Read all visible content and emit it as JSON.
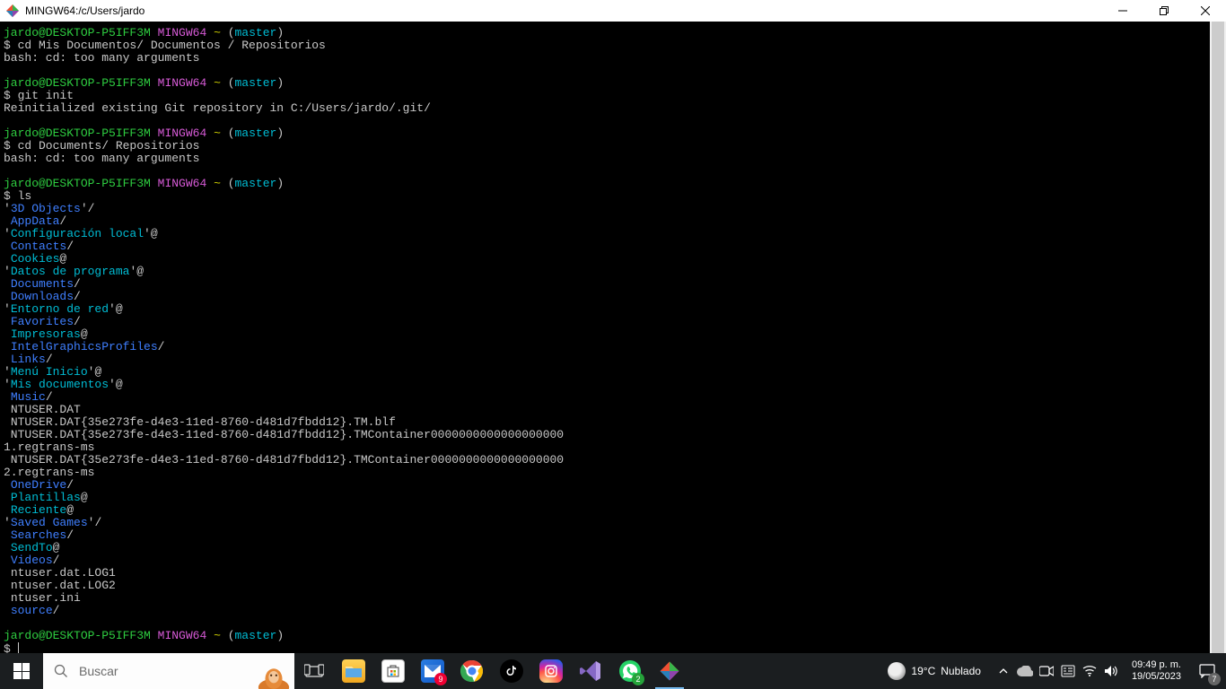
{
  "window": {
    "title": "MINGW64:/c/Users/jardo"
  },
  "prompt": {
    "user_host": "jardo@DESKTOP-P5IFF3M",
    "env": "MINGW64",
    "path": "~",
    "branch_open": "(",
    "branch": "master",
    "branch_close": ")"
  },
  "blocks": [
    {
      "cmd": "$ cd Mis Documentos/ Documentos / Repositorios",
      "out": [
        "bash: cd: too many arguments"
      ]
    },
    {
      "cmd": "$ git init",
      "out": [
        "Reinitialized existing Git repository in C:/Users/jardo/.git/"
      ]
    },
    {
      "cmd": "$ cd Documents/ Repositorios",
      "out": [
        "bash: cd: too many arguments"
      ]
    },
    {
      "cmd": "$ ls",
      "out": []
    }
  ],
  "ls_entries": [
    {
      "pre": "'",
      "name": "3D Objects",
      "suf": "'/",
      "type": "dir"
    },
    {
      "pre": " ",
      "name": "AppData",
      "suf": "/",
      "type": "dir"
    },
    {
      "pre": "'",
      "name": "Configuración local",
      "suf": "'@",
      "type": "link"
    },
    {
      "pre": " ",
      "name": "Contacts",
      "suf": "/",
      "type": "dir"
    },
    {
      "pre": " ",
      "name": "Cookies",
      "suf": "@",
      "type": "link"
    },
    {
      "pre": "'",
      "name": "Datos de programa",
      "suf": "'@",
      "type": "link"
    },
    {
      "pre": " ",
      "name": "Documents",
      "suf": "/",
      "type": "dir"
    },
    {
      "pre": " ",
      "name": "Downloads",
      "suf": "/",
      "type": "dir"
    },
    {
      "pre": "'",
      "name": "Entorno de red",
      "suf": "'@",
      "type": "link"
    },
    {
      "pre": " ",
      "name": "Favorites",
      "suf": "/",
      "type": "dir"
    },
    {
      "pre": " ",
      "name": "Impresoras",
      "suf": "@",
      "type": "link"
    },
    {
      "pre": " ",
      "name": "IntelGraphicsProfiles",
      "suf": "/",
      "type": "dir"
    },
    {
      "pre": " ",
      "name": "Links",
      "suf": "/",
      "type": "dir"
    },
    {
      "pre": "'",
      "name": "Menú Inicio",
      "suf": "'@",
      "type": "link"
    },
    {
      "pre": "'",
      "name": "Mis documentos",
      "suf": "'@",
      "type": "link"
    },
    {
      "pre": " ",
      "name": "Music",
      "suf": "/",
      "type": "dir"
    },
    {
      "pre": " ",
      "name": "NTUSER.DAT",
      "suf": "",
      "type": "file"
    },
    {
      "pre": " ",
      "name": "NTUSER.DAT{35e273fe-d4e3-11ed-8760-d481d7fbdd12}.TM.blf",
      "suf": "",
      "type": "file"
    },
    {
      "pre": " ",
      "name": "NTUSER.DAT{35e273fe-d4e3-11ed-8760-d481d7fbdd12}.TMContainer00000000000000000001.regtrans-ms",
      "suf": "",
      "type": "file"
    },
    {
      "pre": " ",
      "name": "NTUSER.DAT{35e273fe-d4e3-11ed-8760-d481d7fbdd12}.TMContainer00000000000000000002.regtrans-ms",
      "suf": "",
      "type": "file"
    },
    {
      "pre": " ",
      "name": "OneDrive",
      "suf": "/",
      "type": "dir"
    },
    {
      "pre": " ",
      "name": "Plantillas",
      "suf": "@",
      "type": "link"
    },
    {
      "pre": " ",
      "name": "Reciente",
      "suf": "@",
      "type": "link"
    },
    {
      "pre": "'",
      "name": "Saved Games",
      "suf": "'/",
      "type": "dir"
    },
    {
      "pre": " ",
      "name": "Searches",
      "suf": "/",
      "type": "dir"
    },
    {
      "pre": " ",
      "name": "SendTo",
      "suf": "@",
      "type": "link"
    },
    {
      "pre": " ",
      "name": "Videos",
      "suf": "/",
      "type": "dir"
    },
    {
      "pre": " ",
      "name": "ntuser.dat.LOG1",
      "suf": "",
      "type": "file"
    },
    {
      "pre": " ",
      "name": "ntuser.dat.LOG2",
      "suf": "",
      "type": "file"
    },
    {
      "pre": " ",
      "name": "ntuser.ini",
      "suf": "",
      "type": "file"
    },
    {
      "pre": " ",
      "name": "source",
      "suf": "/",
      "type": "dir"
    }
  ],
  "final_prompt": "$ ",
  "taskbar": {
    "search_placeholder": "Buscar",
    "weather_temp": "19°C",
    "weather_desc": "Nublado",
    "time": "09:49 p. m.",
    "date": "19/05/2023",
    "mail_badge": "9",
    "whatsapp_badge": "2",
    "notif_badge": "7"
  },
  "icons": {
    "taskview": "task-view-icon",
    "explorer": "file-explorer-icon",
    "store": "ms-store-icon",
    "mail": "mail-icon",
    "chrome": "chrome-icon",
    "tiktok": "tiktok-icon",
    "instagram": "instagram-icon",
    "vs": "visual-studio-icon",
    "whatsapp": "whatsapp-icon",
    "git": "git-bash-icon",
    "chevron": "tray-chevron-icon",
    "onedrive": "onedrive-icon",
    "meet": "meet-now-icon",
    "ime": "ime-icon",
    "wifi": "wifi-icon",
    "volume": "volume-icon",
    "notif": "notifications-icon"
  }
}
